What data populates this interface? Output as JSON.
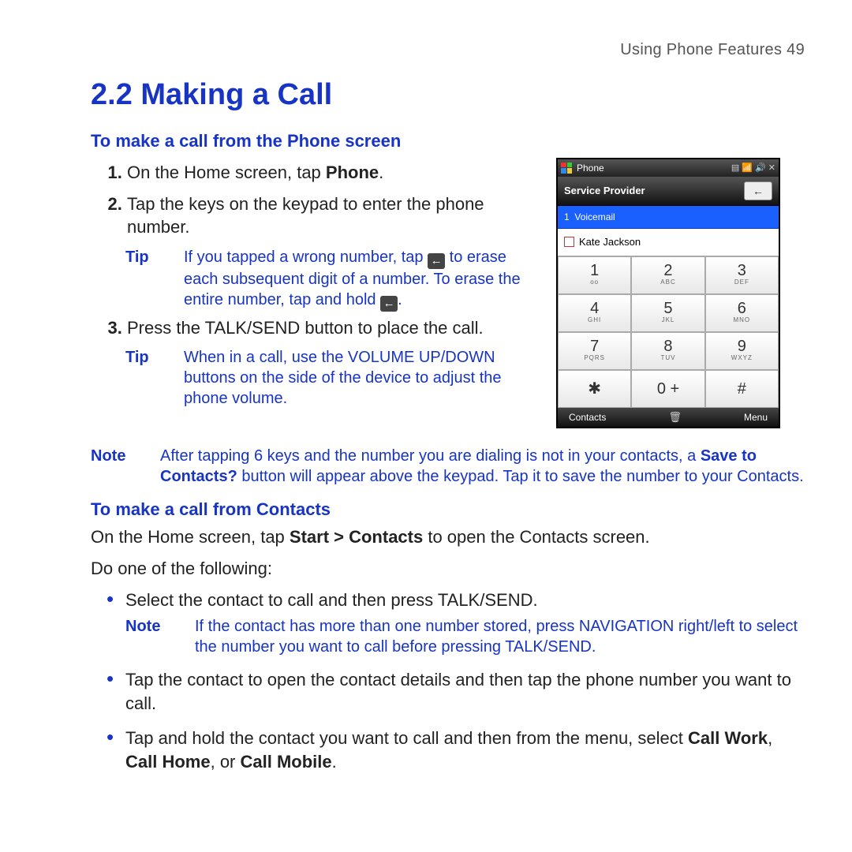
{
  "running_head": "Using Phone Features  49",
  "section_title": "2.2 Making a Call",
  "sub1": "To make a call from the Phone screen",
  "steps": {
    "s1_pre": "On the Home screen, tap ",
    "s1_bold": "Phone",
    "s1_post": ".",
    "s2": "Tap the keys on the keypad to enter the phone number.",
    "s3": "Press the TALK/SEND button to place the call."
  },
  "tip1": {
    "label": "Tip",
    "pre": "If you tapped a wrong number, tap ",
    "mid": " to erase each subsequent digit of a number. To erase the entire number, tap and hold ",
    "post": "."
  },
  "tip2": {
    "label": "Tip",
    "body": "When in a call, use the VOLUME UP/DOWN buttons on the side of the device to adjust the phone volume."
  },
  "note1": {
    "label": "Note",
    "pre": "After tapping 6 keys and the number you are dialing is not in your contacts, a ",
    "bold": "Save to Contacts?",
    "post": " button will appear above the keypad. Tap it to save the number to your Contacts."
  },
  "sub2": "To make a call from Contacts",
  "para2a_pre": "On the Home screen, tap ",
  "para2a_bold": "Start > Contacts",
  "para2a_post": " to open the Contacts screen.",
  "para2b": "Do one of the following:",
  "bullets": {
    "b1": "Select the contact to call and then press TALK/SEND.",
    "b1note_label": "Note",
    "b1note": "If the contact has more than one number stored, press NAVIGATION right/left to select the number you want to call before pressing TALK/SEND.",
    "b2": "Tap the contact to open the contact details and then tap the phone number you want to call.",
    "b3_pre": "Tap and hold the contact you want to call and then from the menu, select ",
    "b3_bold": "Call Work",
    "b3_mid1": ", ",
    "b3_bold2": "Call Home",
    "b3_mid2": ", or ",
    "b3_bold3": "Call Mobile",
    "b3_post": "."
  },
  "phone": {
    "title": "Phone",
    "provider": "Service Provider",
    "voicemail_idx": "1",
    "voicemail_label": "Voicemail",
    "contact": "Kate Jackson",
    "soft_left": "Contacts",
    "soft_right": "Menu",
    "keys": [
      {
        "n": "1",
        "l": "oo"
      },
      {
        "n": "2",
        "l": "ABC"
      },
      {
        "n": "3",
        "l": "DEF"
      },
      {
        "n": "4",
        "l": "GHI"
      },
      {
        "n": "5",
        "l": "JKL"
      },
      {
        "n": "6",
        "l": "MNO"
      },
      {
        "n": "7",
        "l": "PQRS"
      },
      {
        "n": "8",
        "l": "TUV"
      },
      {
        "n": "9",
        "l": "WXYZ"
      },
      {
        "n": "✱",
        "l": ""
      },
      {
        "n": "0 +",
        "l": ""
      },
      {
        "n": "#",
        "l": ""
      }
    ]
  }
}
